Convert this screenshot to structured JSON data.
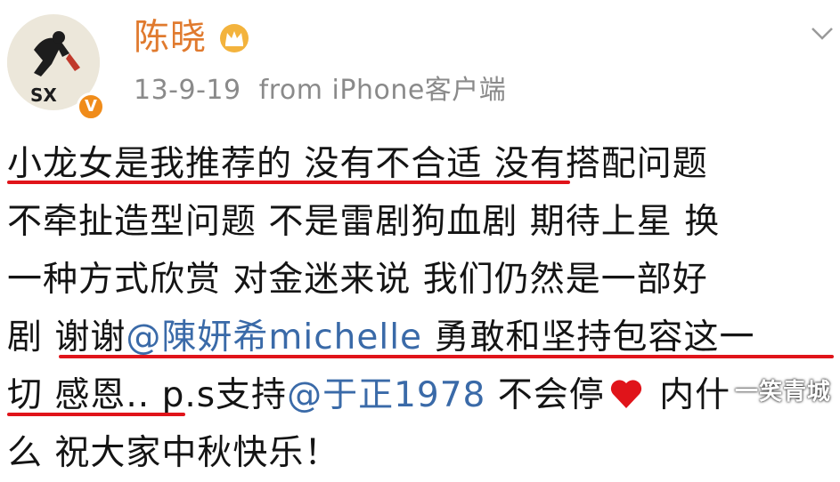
{
  "post": {
    "username": "陈晓",
    "date": "13-9-19",
    "source": "from iPhone客户端",
    "lines": [
      [
        "小龙女是我推荐的 没有不合适 没有搭配问题"
      ],
      [
        "不牵扯造型问题 不是雷剧狗血剧 期待上星 换"
      ],
      [
        "一种方式欣赏 对金迷来说 我们仍然是一部好"
      ],
      [
        "剧 谢谢",
        "@陳妍希michelle",
        " 勇敢和坚持包容这一"
      ],
      [
        "切 感恩.. p.s支持",
        "@于正1978",
        " 不会停",
        " 内什"
      ],
      [
        "么 祝大家中秋快乐！"
      ]
    ],
    "avatar_text": "SX",
    "verified_badge": "V",
    "watermark": "一笑青城"
  },
  "colors": {
    "username": "#e07a2e",
    "mention": "#3a6aa8",
    "underline": "#e0141a",
    "meta": "#8a8a8a"
  },
  "icons": [
    "crown-icon",
    "verified-icon",
    "chevron-down-icon",
    "heart-icon"
  ]
}
